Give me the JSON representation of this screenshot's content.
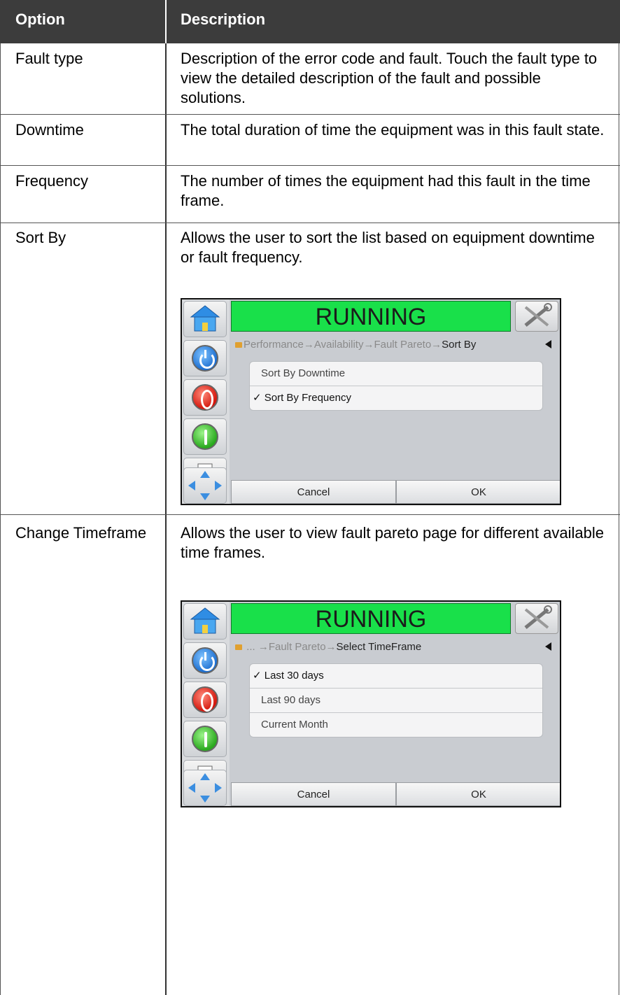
{
  "header": {
    "option": "Option",
    "description": "Description"
  },
  "rows": [
    {
      "option": "Fault type",
      "description": "Description of the error code and fault. Touch the fault type to view the detailed description of the fault and possible solutions."
    },
    {
      "option": "Downtime",
      "description": "The total duration of time the equipment was in this fault state."
    },
    {
      "option": "Frequency",
      "description": "The number of times the equipment had this fault in the time frame."
    },
    {
      "option": "Sort By",
      "description": "Allows the user to sort the list based on equipment downtime or fault frequency."
    },
    {
      "option": "Change Timeframe",
      "description": "Allows the user to view fault pareto page for different available time frames."
    }
  ],
  "screens": [
    {
      "status": "RUNNING",
      "status_color": "#19e04a",
      "breadcrumb_prefix": "Performance→Availability→Fault Pareto→",
      "breadcrumb_last": "Sort By",
      "items": [
        "Sort By Downtime",
        "✓ Sort By Frequency"
      ],
      "cancel": "Cancel",
      "ok": "OK"
    },
    {
      "status": "RUNNING",
      "status_color": "#19e04a",
      "breadcrumb_prefix": " ... →Fault Pareto→",
      "breadcrumb_last": "Select TimeFrame",
      "items": [
        "✓ Last 30 days",
        "Last 90 days",
        "Current Month"
      ],
      "cancel": "Cancel",
      "ok": "OK"
    }
  ]
}
